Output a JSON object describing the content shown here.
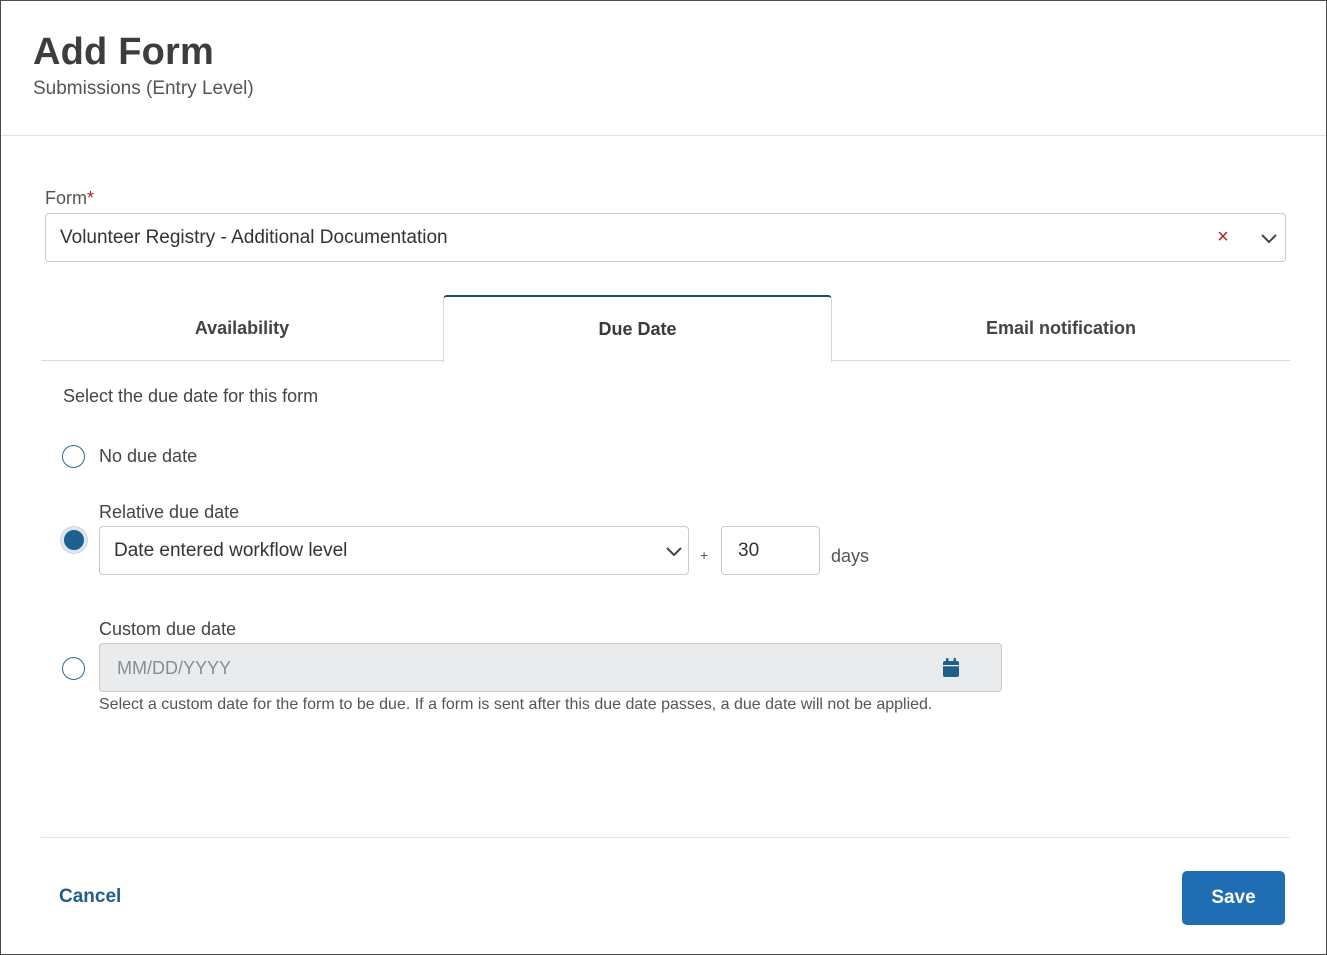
{
  "header": {
    "title": "Add Form",
    "subtitle": "Submissions (Entry Level)"
  },
  "form_field": {
    "label": "Form",
    "required_marker": "*",
    "value": "Volunteer Registry - Additional Documentation",
    "clear_glyph": "×"
  },
  "tabs": [
    {
      "label": "Availability",
      "active": false
    },
    {
      "label": "Due Date",
      "active": true
    },
    {
      "label": "Email notification",
      "active": false
    }
  ],
  "due_date": {
    "instructions": "Select the due date for this form",
    "options": {
      "none": {
        "label": "No due date",
        "selected": false
      },
      "relative": {
        "label": "Relative due date",
        "selected": true
      },
      "custom": {
        "label": "Custom due date",
        "selected": false
      }
    },
    "relative_select_value": "Date entered workflow level",
    "plus": "+",
    "days_value": "30",
    "days_label": "days",
    "custom_placeholder": "MM/DD/YYYY",
    "custom_help": "Select a custom date for the form to be due. If a form is sent after this due date passes, a due date will not be applied."
  },
  "footer": {
    "cancel_label": "Cancel",
    "save_label": "Save"
  },
  "colors": {
    "primary": "#1f6db3",
    "tab_active_border": "#1f4f6e",
    "required": "#b22222",
    "radio": "#1e6191"
  },
  "icons": [
    "close-icon",
    "chevron-down-icon",
    "calendar-icon"
  ]
}
